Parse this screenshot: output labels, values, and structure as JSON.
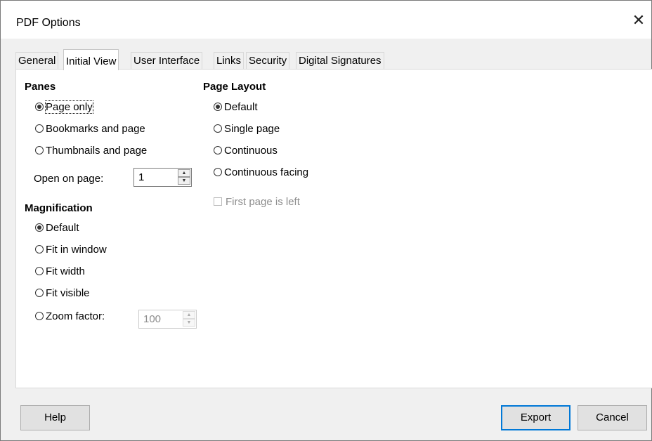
{
  "window": {
    "title": "PDF Options"
  },
  "tabs": [
    "General",
    "Initial View",
    "User Interface",
    "Links",
    "Security",
    "Digital Signatures"
  ],
  "panes": {
    "heading": "Panes",
    "options": [
      {
        "label": "Page only",
        "checked": true
      },
      {
        "label": "Bookmarks and page",
        "checked": false
      },
      {
        "label": "Thumbnails and page",
        "checked": false
      }
    ],
    "open_on_page_label": "Open on page:",
    "open_on_page_value": "1"
  },
  "magnification": {
    "heading": "Magnification",
    "options": [
      {
        "label": "Default",
        "checked": true
      },
      {
        "label": "Fit in window",
        "checked": false
      },
      {
        "label": "Fit width",
        "checked": false
      },
      {
        "label": "Fit visible",
        "checked": false
      },
      {
        "label": "Zoom factor:",
        "checked": false
      }
    ],
    "zoom_value": "100"
  },
  "page_layout": {
    "heading": "Page Layout",
    "options": [
      {
        "label": "Default",
        "checked": true
      },
      {
        "label": "Single page",
        "checked": false
      },
      {
        "label": "Continuous",
        "checked": false
      },
      {
        "label": "Continuous facing",
        "checked": false
      }
    ],
    "first_page_left_label": "First page is left"
  },
  "buttons": {
    "help": "Help",
    "export": "Export",
    "cancel": "Cancel"
  }
}
